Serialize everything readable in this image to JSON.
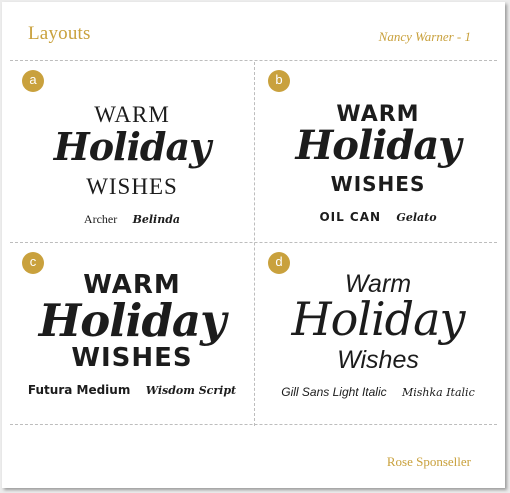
{
  "header": {
    "title": "Layouts",
    "author": "Nancy Warner - 1"
  },
  "panels": [
    {
      "label": "a",
      "line1": "WARM",
      "line2": "Holiday",
      "line3": "WISHES",
      "font1": "Archer",
      "font2": "Belinda"
    },
    {
      "label": "b",
      "line1": "WARM",
      "line2": "Holiday",
      "line3": "WISHES",
      "font1": "OIL CAN",
      "font2": "Gelato"
    },
    {
      "label": "c",
      "line1": "WARM",
      "line2": "Holiday",
      "line3": "WISHES",
      "font1": "Futura Medium",
      "font2": "Wisdom Script"
    },
    {
      "label": "d",
      "line1": "Warm",
      "line2": "Holiday",
      "line3": "Wishes",
      "font1": "Gill Sans Light Italic",
      "font2": "Mishka Italic"
    }
  ],
  "footer": {
    "credit": "Rose Sponseller"
  },
  "colors": {
    "accent": "#c9a13d",
    "text": "#1c1c1c",
    "divider": "#bdbdbd"
  }
}
